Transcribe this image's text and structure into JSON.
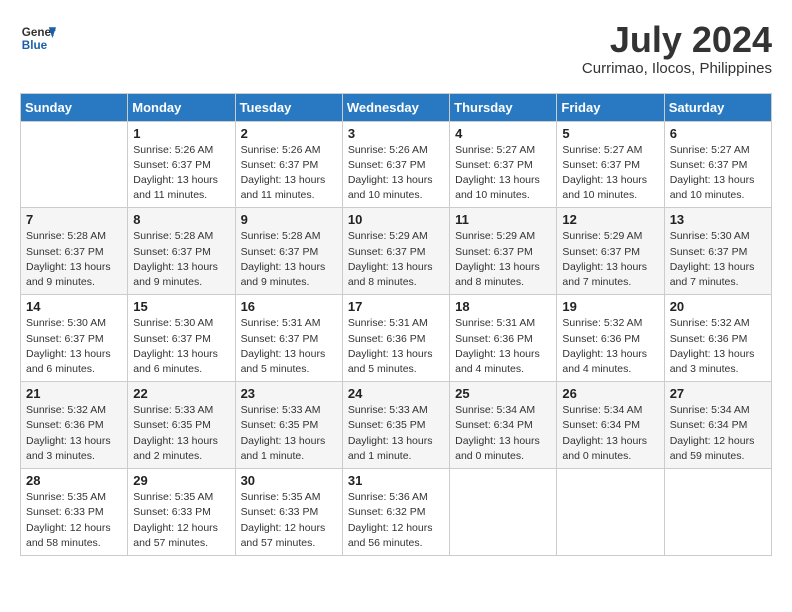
{
  "header": {
    "logo_line1": "General",
    "logo_line2": "Blue",
    "month": "July 2024",
    "location": "Currimao, Ilocos, Philippines"
  },
  "days_of_week": [
    "Sunday",
    "Monday",
    "Tuesday",
    "Wednesday",
    "Thursday",
    "Friday",
    "Saturday"
  ],
  "weeks": [
    [
      {
        "day": "",
        "info": ""
      },
      {
        "day": "1",
        "info": "Sunrise: 5:26 AM\nSunset: 6:37 PM\nDaylight: 13 hours\nand 11 minutes."
      },
      {
        "day": "2",
        "info": "Sunrise: 5:26 AM\nSunset: 6:37 PM\nDaylight: 13 hours\nand 11 minutes."
      },
      {
        "day": "3",
        "info": "Sunrise: 5:26 AM\nSunset: 6:37 PM\nDaylight: 13 hours\nand 10 minutes."
      },
      {
        "day": "4",
        "info": "Sunrise: 5:27 AM\nSunset: 6:37 PM\nDaylight: 13 hours\nand 10 minutes."
      },
      {
        "day": "5",
        "info": "Sunrise: 5:27 AM\nSunset: 6:37 PM\nDaylight: 13 hours\nand 10 minutes."
      },
      {
        "day": "6",
        "info": "Sunrise: 5:27 AM\nSunset: 6:37 PM\nDaylight: 13 hours\nand 10 minutes."
      }
    ],
    [
      {
        "day": "7",
        "info": "Sunrise: 5:28 AM\nSunset: 6:37 PM\nDaylight: 13 hours\nand 9 minutes."
      },
      {
        "day": "8",
        "info": "Sunrise: 5:28 AM\nSunset: 6:37 PM\nDaylight: 13 hours\nand 9 minutes."
      },
      {
        "day": "9",
        "info": "Sunrise: 5:28 AM\nSunset: 6:37 PM\nDaylight: 13 hours\nand 9 minutes."
      },
      {
        "day": "10",
        "info": "Sunrise: 5:29 AM\nSunset: 6:37 PM\nDaylight: 13 hours\nand 8 minutes."
      },
      {
        "day": "11",
        "info": "Sunrise: 5:29 AM\nSunset: 6:37 PM\nDaylight: 13 hours\nand 8 minutes."
      },
      {
        "day": "12",
        "info": "Sunrise: 5:29 AM\nSunset: 6:37 PM\nDaylight: 13 hours\nand 7 minutes."
      },
      {
        "day": "13",
        "info": "Sunrise: 5:30 AM\nSunset: 6:37 PM\nDaylight: 13 hours\nand 7 minutes."
      }
    ],
    [
      {
        "day": "14",
        "info": "Sunrise: 5:30 AM\nSunset: 6:37 PM\nDaylight: 13 hours\nand 6 minutes."
      },
      {
        "day": "15",
        "info": "Sunrise: 5:30 AM\nSunset: 6:37 PM\nDaylight: 13 hours\nand 6 minutes."
      },
      {
        "day": "16",
        "info": "Sunrise: 5:31 AM\nSunset: 6:37 PM\nDaylight: 13 hours\nand 5 minutes."
      },
      {
        "day": "17",
        "info": "Sunrise: 5:31 AM\nSunset: 6:36 PM\nDaylight: 13 hours\nand 5 minutes."
      },
      {
        "day": "18",
        "info": "Sunrise: 5:31 AM\nSunset: 6:36 PM\nDaylight: 13 hours\nand 4 minutes."
      },
      {
        "day": "19",
        "info": "Sunrise: 5:32 AM\nSunset: 6:36 PM\nDaylight: 13 hours\nand 4 minutes."
      },
      {
        "day": "20",
        "info": "Sunrise: 5:32 AM\nSunset: 6:36 PM\nDaylight: 13 hours\nand 3 minutes."
      }
    ],
    [
      {
        "day": "21",
        "info": "Sunrise: 5:32 AM\nSunset: 6:36 PM\nDaylight: 13 hours\nand 3 minutes."
      },
      {
        "day": "22",
        "info": "Sunrise: 5:33 AM\nSunset: 6:35 PM\nDaylight: 13 hours\nand 2 minutes."
      },
      {
        "day": "23",
        "info": "Sunrise: 5:33 AM\nSunset: 6:35 PM\nDaylight: 13 hours\nand 1 minute."
      },
      {
        "day": "24",
        "info": "Sunrise: 5:33 AM\nSunset: 6:35 PM\nDaylight: 13 hours\nand 1 minute."
      },
      {
        "day": "25",
        "info": "Sunrise: 5:34 AM\nSunset: 6:34 PM\nDaylight: 13 hours\nand 0 minutes."
      },
      {
        "day": "26",
        "info": "Sunrise: 5:34 AM\nSunset: 6:34 PM\nDaylight: 13 hours\nand 0 minutes."
      },
      {
        "day": "27",
        "info": "Sunrise: 5:34 AM\nSunset: 6:34 PM\nDaylight: 12 hours\nand 59 minutes."
      }
    ],
    [
      {
        "day": "28",
        "info": "Sunrise: 5:35 AM\nSunset: 6:33 PM\nDaylight: 12 hours\nand 58 minutes."
      },
      {
        "day": "29",
        "info": "Sunrise: 5:35 AM\nSunset: 6:33 PM\nDaylight: 12 hours\nand 57 minutes."
      },
      {
        "day": "30",
        "info": "Sunrise: 5:35 AM\nSunset: 6:33 PM\nDaylight: 12 hours\nand 57 minutes."
      },
      {
        "day": "31",
        "info": "Sunrise: 5:36 AM\nSunset: 6:32 PM\nDaylight: 12 hours\nand 56 minutes."
      },
      {
        "day": "",
        "info": ""
      },
      {
        "day": "",
        "info": ""
      },
      {
        "day": "",
        "info": ""
      }
    ]
  ]
}
